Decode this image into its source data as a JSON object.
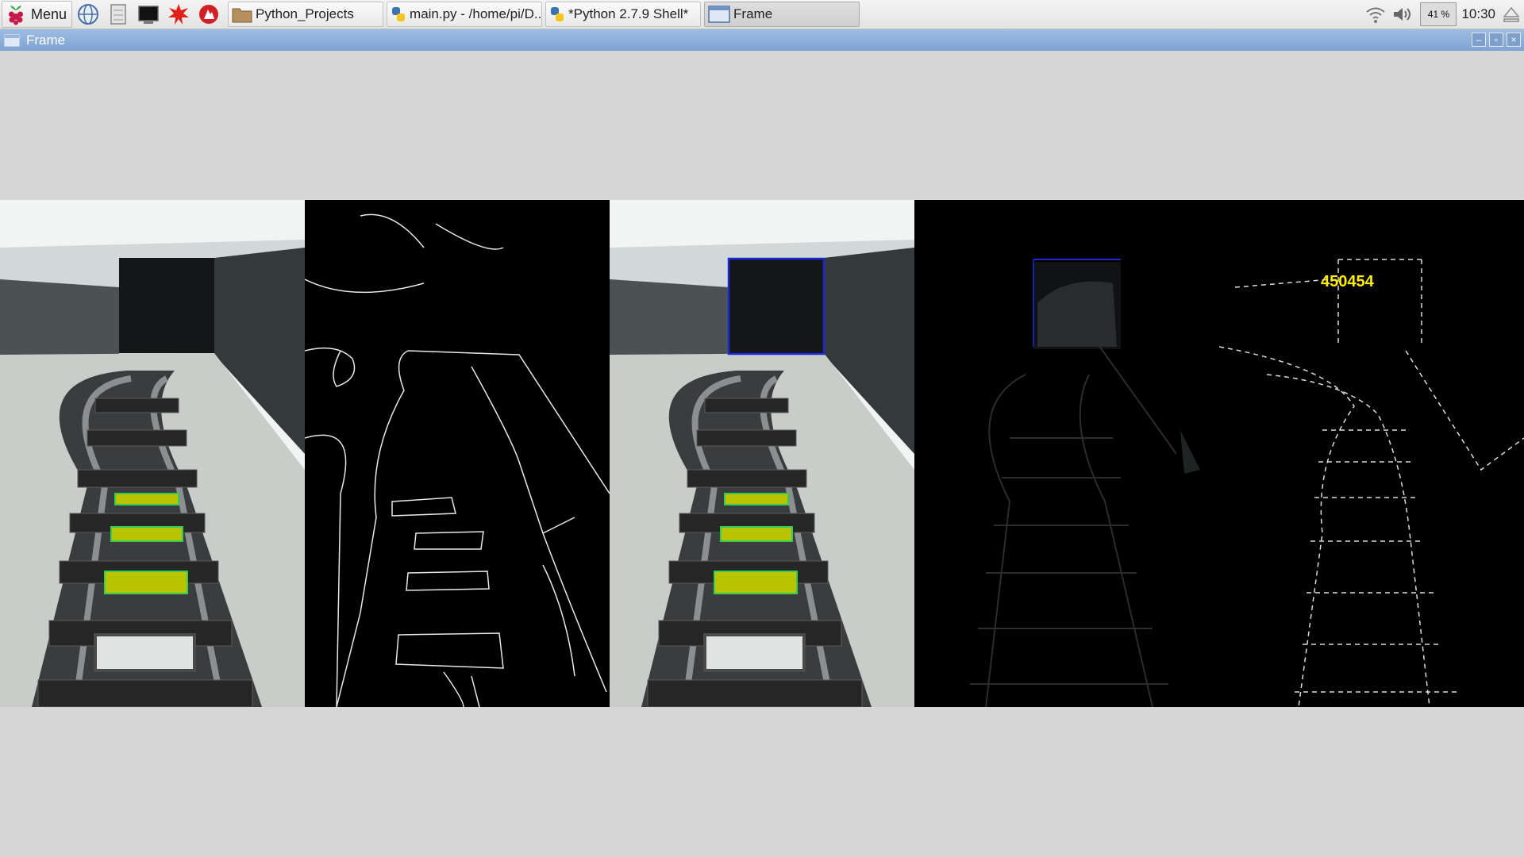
{
  "taskbar": {
    "menu_label": "Menu",
    "launchers": [
      "web-browser-icon",
      "file-manager-icon",
      "terminal-icon",
      "mathematica-icon",
      "wolfram-icon"
    ],
    "tasks": [
      {
        "label": "Python_Projects",
        "icon": "folder-icon"
      },
      {
        "label": "main.py - /home/pi/D...",
        "icon": "python-icon"
      },
      {
        "label": "*Python 2.7.9 Shell*",
        "icon": "python-icon"
      },
      {
        "label": "Frame",
        "icon": "window-icon"
      }
    ],
    "tray": {
      "cpu_percent": "41 %",
      "clock": "10:30",
      "icons": [
        "wifi-icon",
        "volume-icon",
        "eject-icon"
      ]
    }
  },
  "window": {
    "title": "Frame",
    "buttons": [
      "minimize-icon",
      "maximize-icon",
      "close-icon"
    ]
  },
  "frame": {
    "panels": [
      "camera-view-annotated",
      "edge-contour-view",
      "camera-view-with-box",
      "difference-view",
      "edge-view-with-count"
    ],
    "overlay_value": "450454",
    "colors": {
      "highlight_fill": "#b8c400",
      "highlight_border": "#33cc55",
      "detection_box": "#1c2ad6",
      "overlay_text": "#ffee00"
    }
  }
}
